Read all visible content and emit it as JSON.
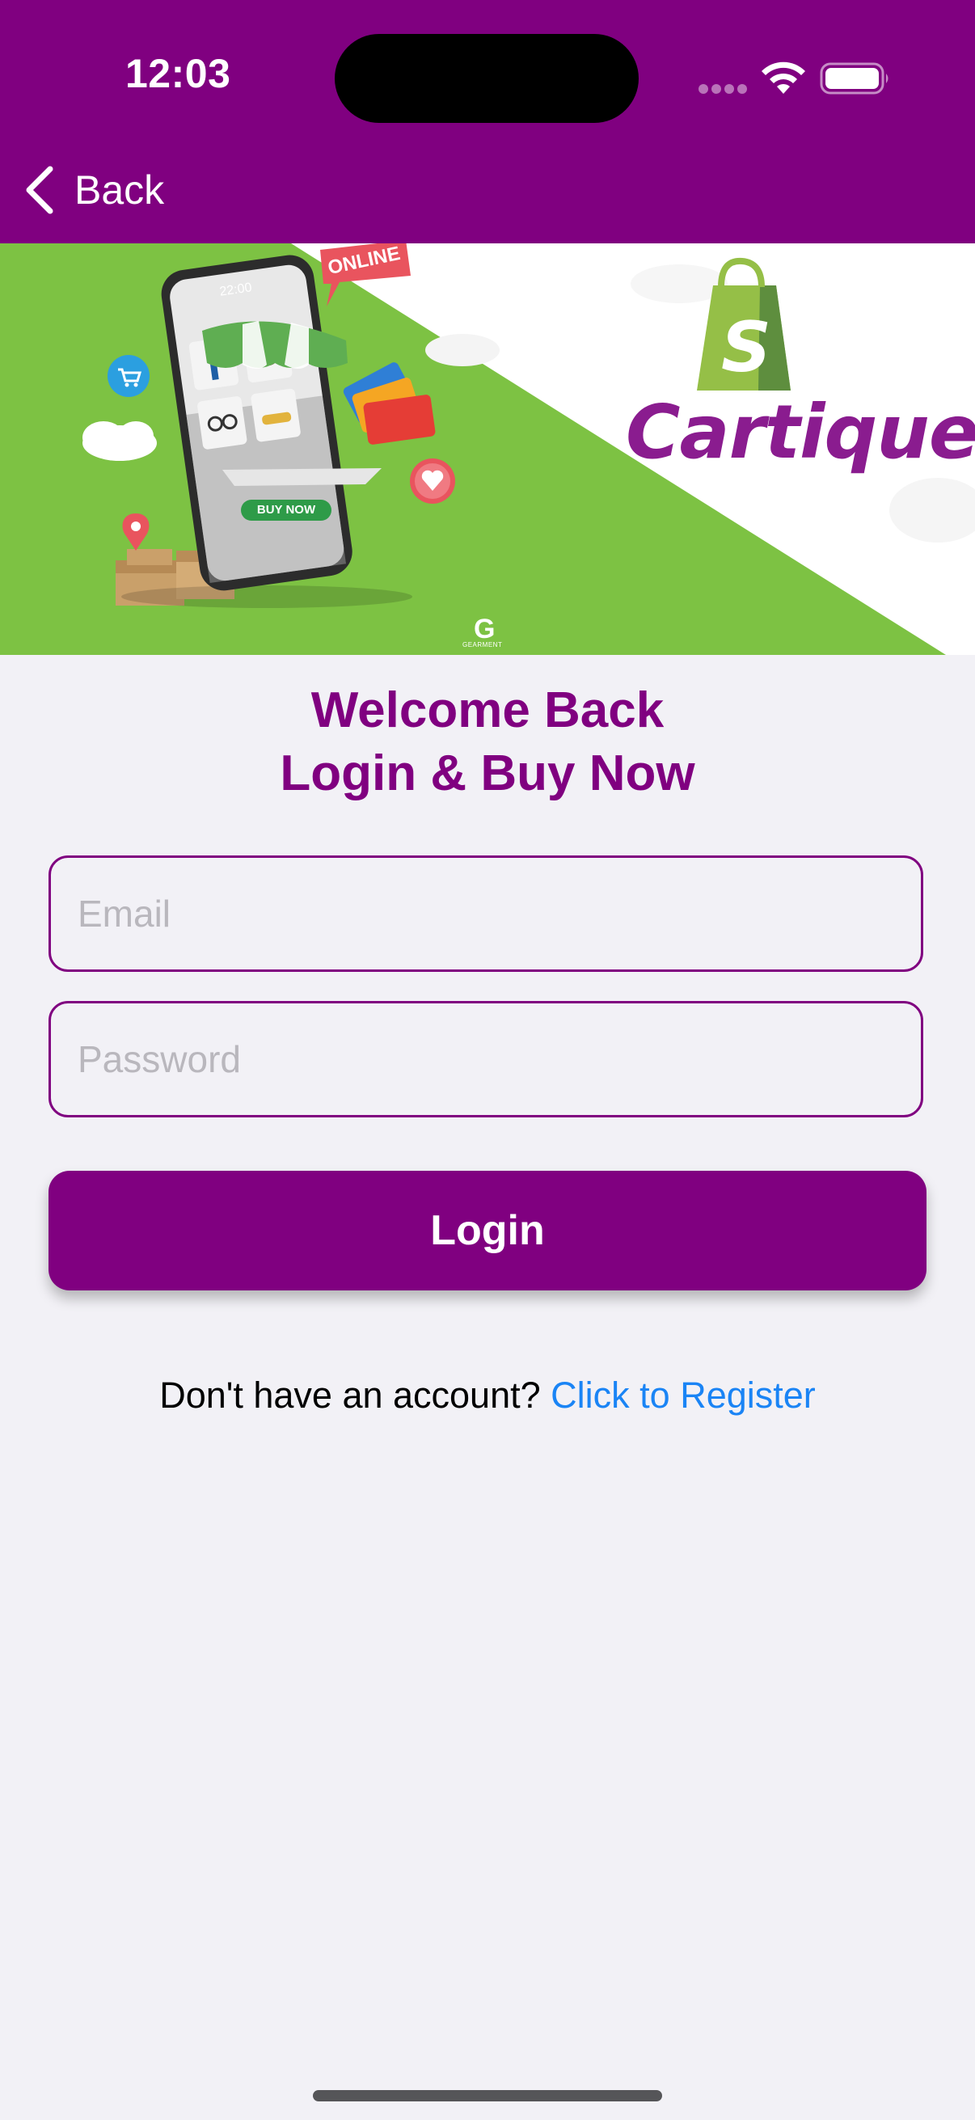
{
  "status_bar": {
    "time": "12:03",
    "icons": [
      "signal-dots-icon",
      "wifi-icon",
      "battery-icon"
    ]
  },
  "nav": {
    "back_label": "Back",
    "back_icon": "chevron-left-icon"
  },
  "banner": {
    "brand_name": "Cartique",
    "online_text": "ONLINE",
    "buy_now_text": "BUY NOW",
    "watermark": "GEARMENT",
    "icons": [
      "shopping-bag-icon",
      "cart-icon",
      "location-pin-icon",
      "heart-icon",
      "credit-card-icon",
      "cloud-icon",
      "box-icon"
    ]
  },
  "welcome": {
    "line1": "Welcome Back",
    "line2": "Login & Buy Now"
  },
  "form": {
    "email_placeholder": "Email",
    "email_value": "",
    "password_placeholder": "Password",
    "password_value": "",
    "login_label": "Login"
  },
  "register": {
    "prompt": "Don't have an account?",
    "link_label": "Click to Register"
  },
  "colors": {
    "primary": "#800080",
    "background": "#f2f1f6",
    "link": "#1a84f5",
    "banner_green": "#7dc243"
  }
}
